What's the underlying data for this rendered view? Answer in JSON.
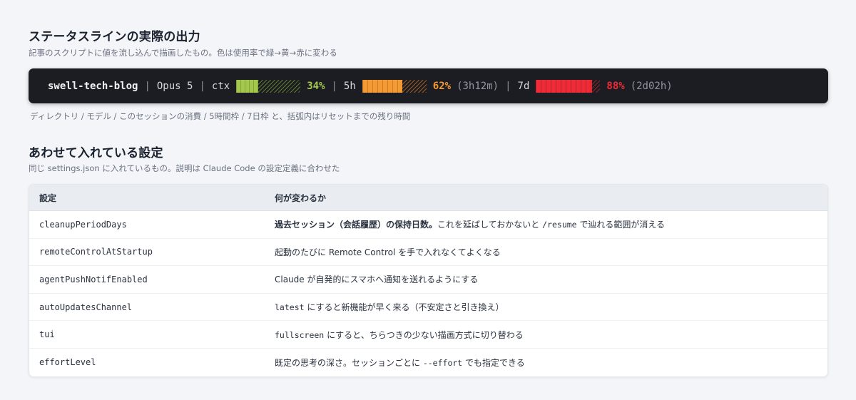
{
  "section1": {
    "title": "ステータスラインの実際の出力",
    "subtitle": "記事のスクリプトに値を流し込んで描画したもの。色は使用率で緑→黄→赤に変わる",
    "caption": "ディレクトリ / モデル / このセッションの消費 / 5時間枠 / 7日枠 と、括弧内はリセットまでの残り時間"
  },
  "statusline": {
    "directory": "swell-tech-blog",
    "separator": "|",
    "model": "Opus 5",
    "ctx": {
      "label": "ctx",
      "percent_text": "34%",
      "fraction": 0.34,
      "color": "#a4c84c"
    },
    "five_hour": {
      "label": "5h",
      "percent_text": "62%",
      "fraction": 0.62,
      "reset": "(3h12m)",
      "color": "#f59a32"
    },
    "seven_day": {
      "label": "7d",
      "percent_text": "88%",
      "fraction": 0.88,
      "reset": "(2d02h)",
      "color": "#ee2b36"
    }
  },
  "section2": {
    "title": "あわせて入れている設定",
    "subtitle": "同じ settings.json に入れているもの。説明は Claude Code の設定定義に合わせた"
  },
  "table": {
    "headers": [
      "設定",
      "何が変わるか"
    ],
    "rows": [
      {
        "key": "cleanupPeriodDays",
        "bold": "過去セッション（会話履歴）の保持日数。",
        "pre": "これを延ばしておかないと ",
        "code": "/resume",
        "post": " で辿れる範囲が消える"
      },
      {
        "key": "remoteControlAtStartup",
        "bold": "",
        "pre": "起動のたびに Remote Control を手で入れなくてよくなる",
        "code": "",
        "post": ""
      },
      {
        "key": "agentPushNotifEnabled",
        "bold": "",
        "pre": "Claude が自発的にスマホへ通知を送れるようにする",
        "code": "",
        "post": ""
      },
      {
        "key": "autoUpdatesChannel",
        "bold": "",
        "pre": "",
        "code": "latest",
        "post": " にすると新機能が早く来る（不安定さと引き換え）"
      },
      {
        "key": "tui",
        "bold": "",
        "pre": "",
        "code": "fullscreen",
        "post": " にすると、ちらつきの少ない描画方式に切り替わる"
      },
      {
        "key": "effortLevel",
        "bold": "",
        "pre": "既定の思考の深さ。セッションごとに ",
        "code": "--effort",
        "post": " でも指定できる"
      }
    ]
  }
}
